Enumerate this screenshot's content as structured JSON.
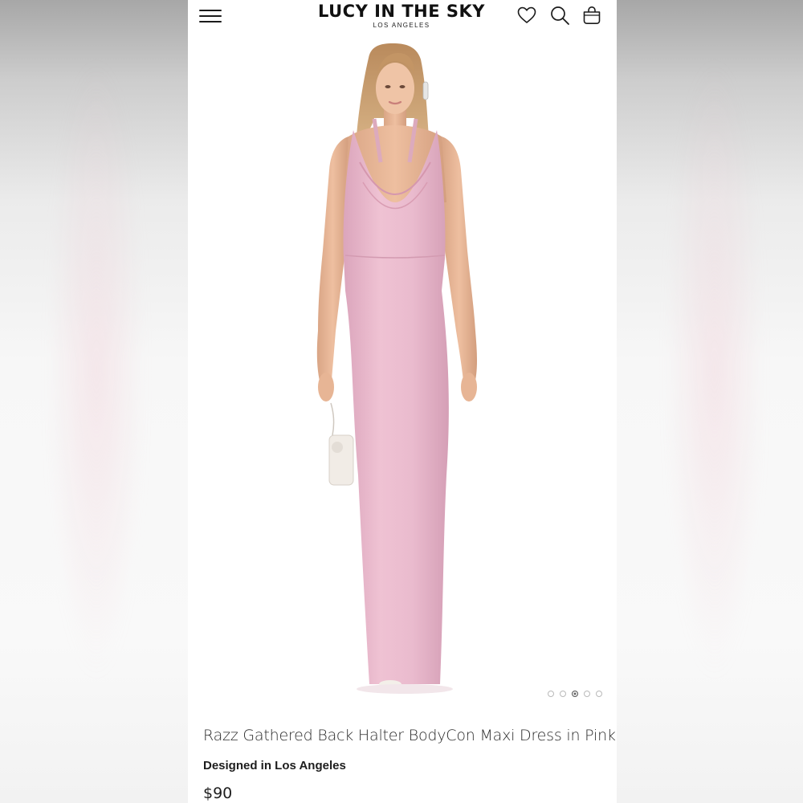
{
  "header": {
    "brand_name": "LUCY IN THE SKY",
    "brand_sub": "LOS ANGELES",
    "icons": [
      "menu-icon",
      "heart-icon",
      "search-icon",
      "bag-icon"
    ]
  },
  "gallery": {
    "image_count": 5,
    "active_index": 3
  },
  "product": {
    "title": "Razz Gathered Back Halter BodyCon Maxi Dress in Pink",
    "designed_label": "Designed in Los Angeles",
    "price": "$90"
  },
  "colors": {
    "dress": "#e9b8cc",
    "text": "#1d1d1d",
    "background": "#ffffff"
  }
}
